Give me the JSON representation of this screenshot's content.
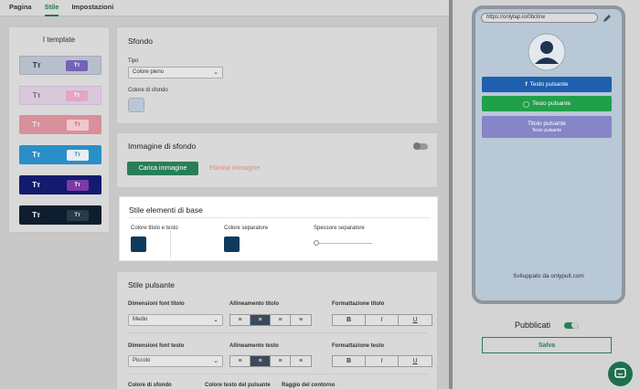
{
  "tabs": [
    "Pagina",
    "Stile",
    "Impostazioni"
  ],
  "templates": {
    "title": "I template",
    "glyph": "Tт"
  },
  "sfondo": {
    "title": "Sfondo",
    "tipo_label": "Tipo",
    "tipo_value": "Colore pieno",
    "color_label": "Colore di sfondo",
    "swatch_color": "#b9c7d8"
  },
  "immagine": {
    "title": "Immagine di sfondo",
    "upload": "Carica immagine",
    "remove": "Elimina immagine"
  },
  "base": {
    "title": "Stile elementi di base",
    "title_color_label": "Colore titolo e testo",
    "separator_color_label": "Colore separatore",
    "separator_thickness_label": "Spessore separatore",
    "dark_color": "#0e3a5e"
  },
  "pulsante": {
    "title": "Stile pulsante",
    "font_title_label": "Dimensioni font titolo",
    "font_title_value": "Medio",
    "align_title_label": "Allineamento titolo",
    "format_title_label": "Formattazione titolo",
    "font_text_label": "Dimensioni font testo",
    "font_text_value": "Piccolo",
    "align_text_label": "Allineamento testo",
    "format_text_label": "Formattazione testo",
    "bg_label": "Colore di sfondo",
    "text_color_label": "Colore testo del pulsante",
    "radius_label": "Raggio del contorno",
    "format_buttons": [
      "B",
      "I",
      "U"
    ]
  },
  "preview": {
    "url": "https://onlytap.io/0bclirw",
    "buttons": [
      {
        "label": "Testo pulsante",
        "color": "#1e5fae",
        "icon": "facebook-icon"
      },
      {
        "label": "Testo pulsante",
        "color": "#21a04a",
        "icon": "whatsapp-icon"
      }
    ],
    "custom_button": {
      "title": "Titolo pulsante",
      "subtitle": "Testo pulsante",
      "color": "#8585c8"
    },
    "footer": "Sviluppato da onlypult.com"
  },
  "publish": {
    "label": "Pubblicati",
    "save": "Salva"
  }
}
